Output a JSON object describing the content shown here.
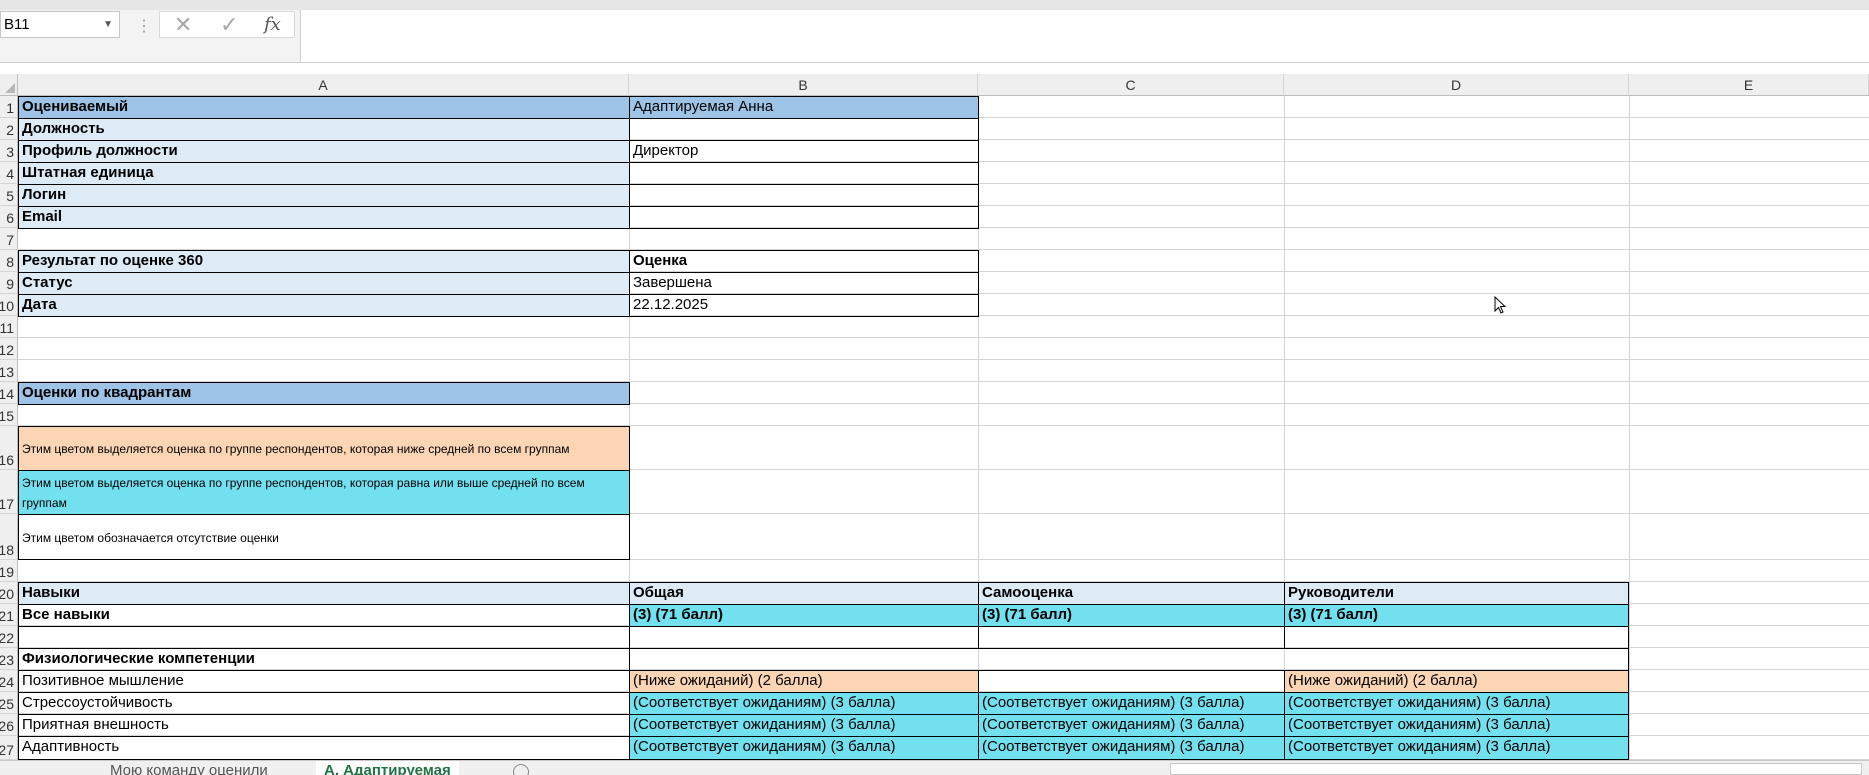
{
  "formula_bar": {
    "name_box": "B11",
    "formula": ""
  },
  "columns": [
    "A",
    "B",
    "C",
    "D",
    "E"
  ],
  "rows": [
    "1",
    "2",
    "3",
    "4",
    "5",
    "6",
    "7",
    "8",
    "9",
    "10",
    "11",
    "12",
    "13",
    "14",
    "15",
    "16",
    "17",
    "18",
    "19",
    "20",
    "21",
    "22",
    "23",
    "24",
    "25",
    "26",
    "27"
  ],
  "cells": {
    "A1": "Оцениваемый",
    "B1": "Адаптируемая Анна",
    "A2": "Должность",
    "A3": "Профиль должности",
    "B3": "Директор",
    "A4": "Штатная единица",
    "A5": "Логин",
    "A6": "Email",
    "A8": "Результат по оценке 360",
    "B8": "Оценка",
    "A9": "Статус",
    "B9": "Завершена",
    "A10": "Дата",
    "B10": "22.12.2025",
    "A14": "Оценки по квадрантам",
    "A16": "Этим цветом выделяется оценка по группе респондентов, которая ниже средней по всем группам",
    "A17": "Этим цветом выделяется оценка по группе респондентов, которая равна или выше средней по всем группам",
    "A18": "Этим цветом обозначается отсутствие оценки",
    "A20": "Навыки",
    "B20": "Общая",
    "C20": "Самооценка",
    "D20": "Руководители",
    "A21": "Все навыки",
    "B21": "(3) (71 балл)",
    "C21": "(3) (71 балл)",
    "D21": "(3) (71 балл)",
    "A23": "Физиологические компетенции",
    "A24": "Позитивное мышление",
    "B24": "(Ниже ожиданий) (2 балла)",
    "D24": "(Ниже ожиданий) (2 балла)",
    "A25": "Стрессоустойчивость",
    "B25": "(Соответствует ожиданиям) (3 балла)",
    "C25": "(Соответствует ожиданиям) (3 балла)",
    "D25": "(Соответствует ожиданиям) (3 балла)",
    "A26": "Приятная внешность",
    "B26": "(Соответствует ожиданиям) (3 балла)",
    "C26": "(Соответствует ожиданиям) (3 балла)",
    "D26": "(Соответствует ожиданиям) (3 балла)",
    "A27": "Адаптивность",
    "B27": "(Соответствует ожиданиям) (3 балла)",
    "C27": "(Соответствует ожиданиям) (3 балла)",
    "D27": "(Соответствует ожиданиям) (3 балла)"
  },
  "sheet_tabs": [
    "Мою команду оценили",
    "А. Адаптируемая"
  ],
  "active_tab": "А. Адаптируемая",
  "colors": {
    "header_blue": "#9dc3e6",
    "light_blue": "#ddebf7",
    "below_average": "#fcd5b4",
    "at_or_above_average": "#72e0ee",
    "tab_active": "#217346"
  }
}
